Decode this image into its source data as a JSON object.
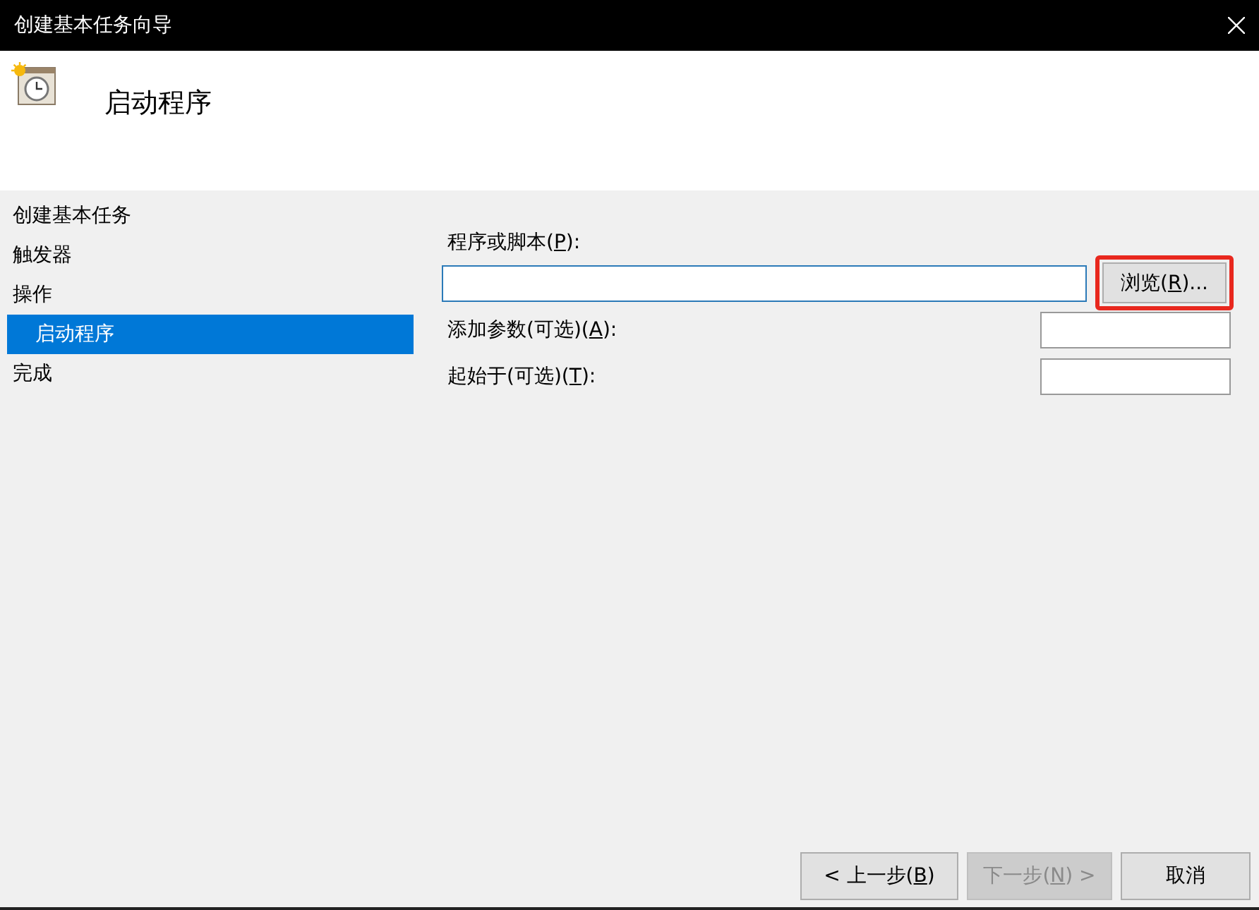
{
  "window": {
    "title": "创建基本任务向导"
  },
  "header": {
    "title": "启动程序"
  },
  "sidebar": {
    "items": [
      {
        "label": "创建基本任务",
        "selected": false
      },
      {
        "label": "触发器",
        "selected": false
      },
      {
        "label": "操作",
        "selected": false,
        "children": [
          {
            "label": "启动程序",
            "selected": true
          }
        ]
      },
      {
        "label": "完成",
        "selected": false
      }
    ]
  },
  "form": {
    "program": {
      "label": "程序或脚本(",
      "mnemonic": "P",
      "label_end": "):"
    },
    "browse": {
      "label": "浏览(",
      "mnemonic": "R",
      "label_end": ")...",
      "highlighted": true
    },
    "arguments": {
      "label": "添加参数(可选)(",
      "mnemonic": "A",
      "label_end": "):"
    },
    "start_in": {
      "label": "起始于(可选)(",
      "mnemonic": "T",
      "label_end": "):"
    }
  },
  "buttons": [
    {
      "kind": "back",
      "label": "< 上一步(",
      "mnemonic": "B",
      "label_end": ")",
      "disabled": false
    },
    {
      "kind": "next",
      "label": "下一步(",
      "mnemonic": "N",
      "label_end": ") >",
      "disabled": true
    },
    {
      "kind": "cancel",
      "label": "取消",
      "disabled": false
    }
  ]
}
